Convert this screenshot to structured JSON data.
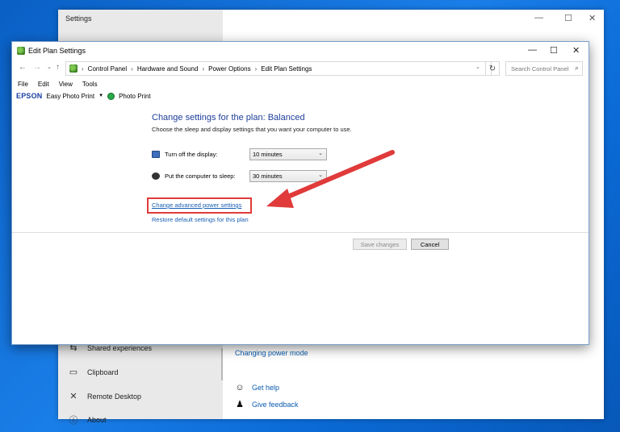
{
  "settings_window": {
    "title": "Settings",
    "nav_items": [
      {
        "label": "Shared experiences",
        "icon": "shared-experiences-icon"
      },
      {
        "label": "Clipboard",
        "icon": "clipboard-icon"
      },
      {
        "label": "Remote Desktop",
        "icon": "remote-desktop-icon"
      },
      {
        "label": "About",
        "icon": "info-icon"
      }
    ],
    "related_link": "Changing power mode",
    "help_links": [
      {
        "label": "Get help",
        "icon": "help-chat-icon"
      },
      {
        "label": "Give feedback",
        "icon": "feedback-icon"
      }
    ],
    "controls": {
      "minimize": "—",
      "maximize": "☐",
      "close": "✕"
    }
  },
  "edit_window": {
    "title": "Edit Plan Settings",
    "controls": {
      "minimize": "—",
      "maximize": "☐",
      "close": "✕"
    },
    "address": {
      "breadcrumbs": [
        "Control Panel",
        "Hardware and Sound",
        "Power Options",
        "Edit Plan Settings"
      ],
      "search_placeholder": "Search Control Panel"
    },
    "menu": [
      "File",
      "Edit",
      "View",
      "Tools"
    ],
    "epson": {
      "brand": "EPSON",
      "easy_photo_print": "Easy Photo Print",
      "photo_print": "Photo Print"
    },
    "heading": "Change settings for the plan: Balanced",
    "subheading": "Choose the sleep and display settings that you want your computer to use.",
    "settings": [
      {
        "label": "Turn off the display:",
        "value": "10 minutes",
        "icon": "display-icon"
      },
      {
        "label": "Put the computer to sleep:",
        "value": "30 minutes",
        "icon": "sleep-icon"
      }
    ],
    "advanced_link": "Change advanced power settings",
    "restore_link": "Restore default settings for this plan",
    "save_label": "Save changes",
    "cancel_label": "Cancel"
  },
  "colors": {
    "accent_link": "#1a5fb4",
    "heading": "#1e3f9a",
    "highlight": "#e03a3a",
    "desktop": "#0b6ad6"
  }
}
